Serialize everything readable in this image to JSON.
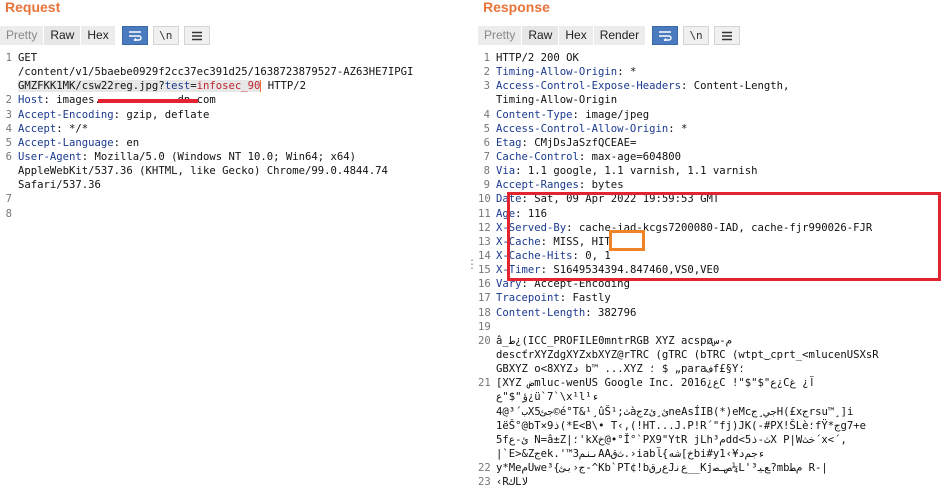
{
  "request": {
    "title": "Request",
    "tabs": [
      "Pretty",
      "Raw",
      "Hex"
    ],
    "lines": [
      {
        "n": "1",
        "segs": [
          {
            "t": "GET"
          }
        ]
      },
      {
        "n": "",
        "segs": [
          {
            "t": "/content/v1/5baebe0929f2cc37ec391d25/1638723879527-AZ63HE7IPGI"
          }
        ]
      },
      {
        "n": "",
        "segs": [
          {
            "t": "GMZFKK1MK/csw22reg.jpg?",
            "c": "sel"
          },
          {
            "t": "test",
            "c": "key sel"
          },
          {
            "t": "=",
            "c": "sel"
          },
          {
            "t": "infosec_90",
            "c": "hl sel"
          },
          {
            "t": " HTTP/2"
          }
        ]
      },
      {
        "n": "2",
        "segs": [
          {
            "t": "Host",
            "c": "key"
          },
          {
            "t": ": images."
          },
          {
            "t": "            "
          },
          {
            "t": "dn.com"
          }
        ]
      },
      {
        "n": "3",
        "segs": [
          {
            "t": "Accept-Encoding",
            "c": "key"
          },
          {
            "t": ": gzip, deflate"
          }
        ]
      },
      {
        "n": "4",
        "segs": [
          {
            "t": "Accept",
            "c": "key"
          },
          {
            "t": ": */*"
          }
        ]
      },
      {
        "n": "5",
        "segs": [
          {
            "t": "Accept-Language",
            "c": "key"
          },
          {
            "t": ": en"
          }
        ]
      },
      {
        "n": "6",
        "segs": [
          {
            "t": "User-Agent",
            "c": "key"
          },
          {
            "t": ": Mozilla/5.0 (Windows NT 10.0; Win64; x64)"
          }
        ]
      },
      {
        "n": "",
        "segs": [
          {
            "t": "AppleWebKit/537.36 (KHTML, like Gecko) Chrome/99.0.4844.74"
          }
        ]
      },
      {
        "n": "",
        "segs": [
          {
            "t": "Safari/537.36"
          }
        ]
      },
      {
        "n": "7",
        "segs": []
      },
      {
        "n": "8",
        "segs": []
      }
    ]
  },
  "response": {
    "title": "Response",
    "tabs": [
      "Pretty",
      "Raw",
      "Hex",
      "Render"
    ],
    "lines": [
      {
        "n": "1",
        "segs": [
          {
            "t": "HTTP/2 200 OK"
          }
        ]
      },
      {
        "n": "2",
        "segs": [
          {
            "t": "Timing-Allow-Origin",
            "c": "key"
          },
          {
            "t": ": *"
          }
        ]
      },
      {
        "n": "3",
        "segs": [
          {
            "t": "Access-Control-Expose-Headers",
            "c": "key"
          },
          {
            "t": ": Content-Length,"
          }
        ]
      },
      {
        "n": "",
        "segs": [
          {
            "t": "Timing-Allow-Origin"
          }
        ]
      },
      {
        "n": "4",
        "segs": [
          {
            "t": "Content-Type",
            "c": "key"
          },
          {
            "t": ": image/jpeg"
          }
        ]
      },
      {
        "n": "5",
        "segs": [
          {
            "t": "Access-Control-Allow-Origin",
            "c": "key"
          },
          {
            "t": ": *"
          }
        ]
      },
      {
        "n": "6",
        "segs": [
          {
            "t": "Etag",
            "c": "key"
          },
          {
            "t": ": CMjDsJaSzfQCEAE="
          }
        ]
      },
      {
        "n": "7",
        "segs": [
          {
            "t": "Cache-Control",
            "c": "key"
          },
          {
            "t": ": max-age=604800"
          }
        ]
      },
      {
        "n": "8",
        "segs": [
          {
            "t": "Via",
            "c": "key"
          },
          {
            "t": ": 1.1 google, 1.1 varnish, 1.1 varnish"
          }
        ]
      },
      {
        "n": "9",
        "segs": [
          {
            "t": "Accept-Ranges",
            "c": "key"
          },
          {
            "t": ": bytes"
          }
        ]
      },
      {
        "n": "10",
        "segs": [
          {
            "t": "Date",
            "c": "key"
          },
          {
            "t": ": Sat, 09 Apr 2022 19:59:53 GMT"
          }
        ]
      },
      {
        "n": "11",
        "segs": [
          {
            "t": "Age",
            "c": "key"
          },
          {
            "t": ": 116"
          }
        ]
      },
      {
        "n": "12",
        "segs": [
          {
            "t": "X-Served-By",
            "c": "key"
          },
          {
            "t": ": cache-iad-kcgs7200080-IAD, cache-fjr990026-FJR"
          }
        ]
      },
      {
        "n": "13",
        "segs": [
          {
            "t": "X-Cache",
            "c": "key"
          },
          {
            "t": ": MISS, HIT"
          }
        ]
      },
      {
        "n": "14",
        "segs": [
          {
            "t": "X-Cache-Hits",
            "c": "key"
          },
          {
            "t": ": 0, 1"
          }
        ]
      },
      {
        "n": "15",
        "segs": [
          {
            "t": "X-Timer",
            "c": "key"
          },
          {
            "t": ": S1649534394.847460,VS0,VE0"
          }
        ]
      },
      {
        "n": "16",
        "segs": [
          {
            "t": "Vary",
            "c": "key"
          },
          {
            "t": ": Accept-Encoding"
          }
        ]
      },
      {
        "n": "17",
        "segs": [
          {
            "t": "Tracepoint",
            "c": "key"
          },
          {
            "t": ": Fastly"
          }
        ]
      },
      {
        "n": "18",
        "segs": [
          {
            "t": "Content-Length",
            "c": "key"
          },
          {
            "t": ": 382796"
          }
        ]
      },
      {
        "n": "19",
        "segs": []
      },
      {
        "n": "20",
        "segs": [
          {
            "t": "â_ط¿(ICC_PROFILE0mntrRGB XYZ acspøم-س"
          }
        ]
      },
      {
        "n": "",
        "segs": [
          {
            "t": "descťrXYZdgXYZxbXYZ@rTRC (gTRC (bTRC (wtpt‿cprt_<mlucenUSXsR"
          }
        ]
      },
      {
        "n": "",
        "segs": [
          {
            "t": "GBXYZ o<8XYZد b™ ...XYZ ؛ $ „paraفf£§Y؛"
          }
        ]
      },
      {
        "n": "21",
        "segs": [
          {
            "t": "[XYZ ضmluc-wenUS Google Inc. 201ع¿6C !\"$\"$\"ع¿Cآ¿ غ"
          }
        ]
      },
      {
        "n": "",
        "segs": [
          {
            "t": "ؤ\"$\"ع¿ü`7`\\x¹l¹ء"
          }
        ]
      },
      {
        "n": "",
        "segs": [
          {
            "t": "4@ب´³Xجئ5©é°T&¹¸ûŠث;¹àجzئ¸ئneAsÍIB(*)eMcجي¸جH(£xجrsu™¸]i"
          }
        ]
      },
      {
        "n": "",
        "segs": [
          {
            "t": "1ëŠ°@bT×9ذ(*E<B\\• T‹,(!HT...J.P!R´\"fj)JK(-#PX!ŠLè؛fŸ*جg7+e"
          }
        ]
      },
      {
        "n": "",
        "segs": [
          {
            "t": "5fئ-ﻉ N=â±Z|؛'kXخ@•°Ǐ°`PX9\"YtR jLh³مdd<ث-ذ5X P|Wخث´x<´,"
          }
        ]
      },
      {
        "n": "",
        "segs": [
          {
            "t": "|`E>&Zجek.'™ىنم3AAثﻕ.›iabخ]شه}ﺂbi#y1‹¥ءجمﺩ"
          }
        ]
      },
      {
        "n": "22",
        "segs": [
          {
            "t": "y*MeمUwe³{ج‹بئ-^Kb`PT¢!bﻉﺭﻕJﻉﻧ__Kjﺺـﺼ¼L'³ﻊﯿ?mbمﻄ R-|"
          }
        ]
      },
      {
        "n": "23",
        "segs": [
          {
            "t": "‹RكLلا"
          }
        ]
      }
    ]
  }
}
